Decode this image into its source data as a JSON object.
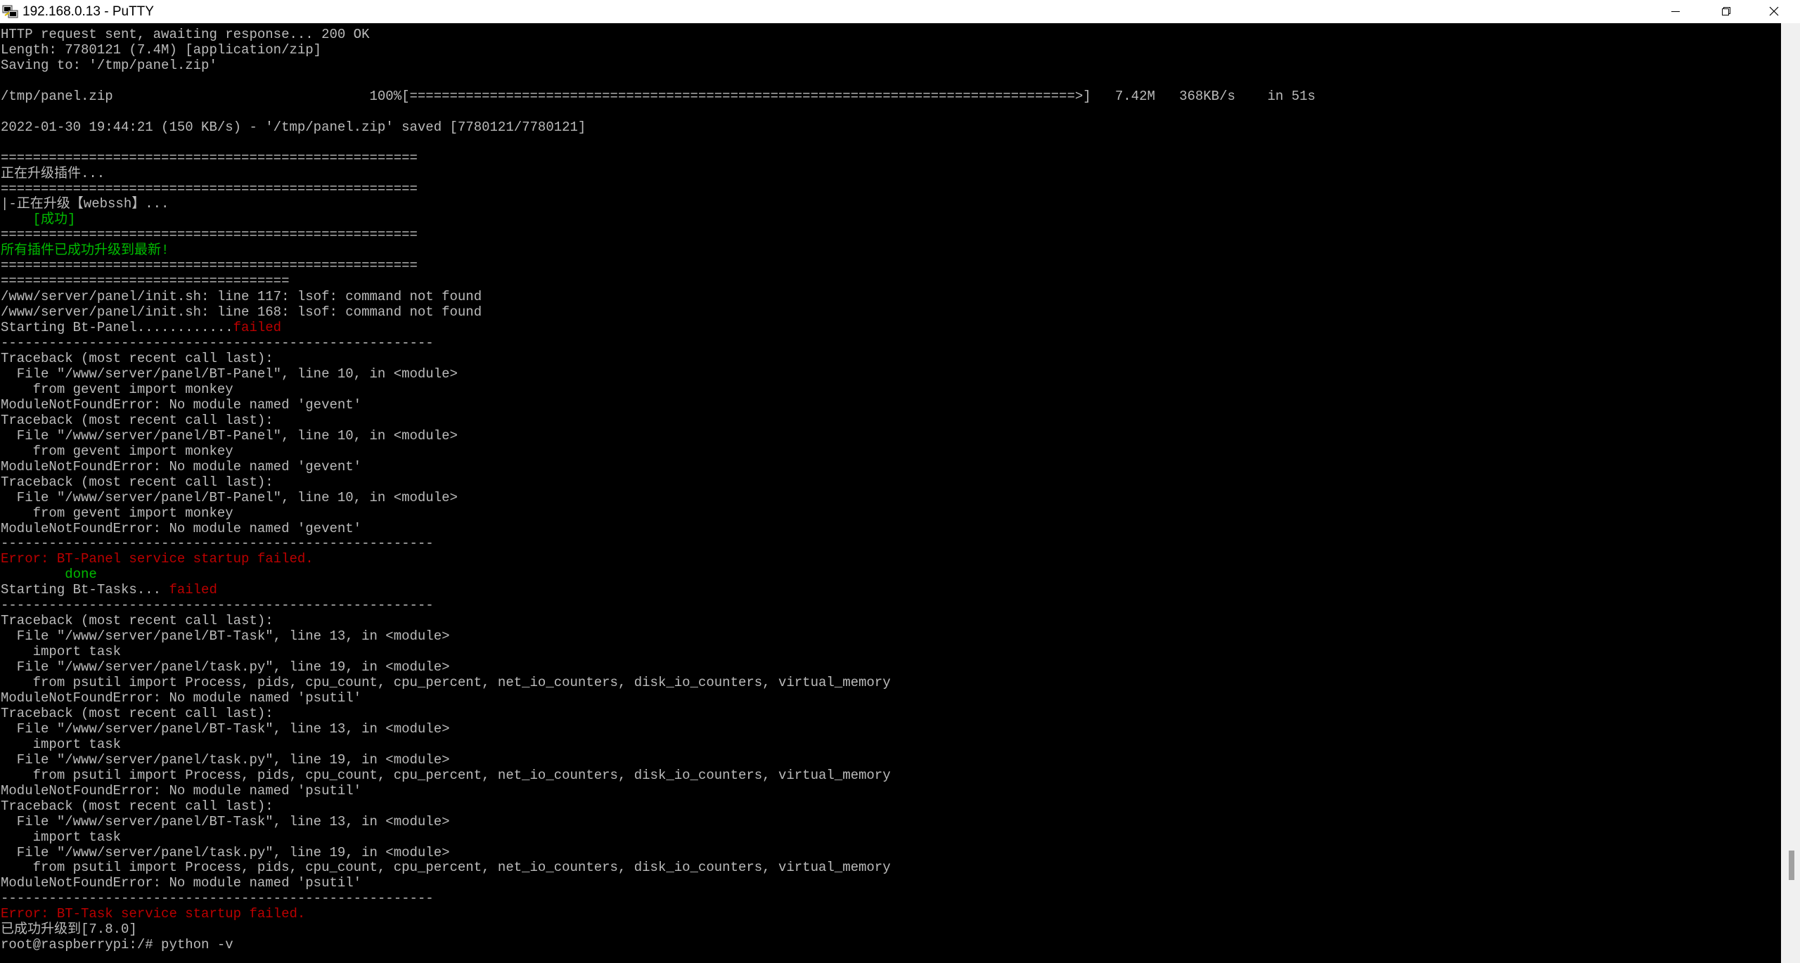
{
  "window": {
    "title": "192.168.0.13 - PuTTY",
    "controls": [
      "minimize",
      "restore",
      "close"
    ]
  },
  "colors": {
    "terminal_bg": "#000000",
    "text_default": "#bbbbbb",
    "text_green": "#00bb00",
    "text_red": "#bb0000"
  },
  "terminal": {
    "lines": [
      [
        {
          "t": "HTTP request sent, awaiting response... 200 OK"
        }
      ],
      [
        {
          "t": "Length: 7780121 (7.4M) [application/zip]"
        }
      ],
      [
        {
          "t": "Saving to: '/tmp/panel.zip'"
        }
      ],
      [
        {
          "t": ""
        }
      ],
      [
        {
          "t": "/tmp/panel.zip                                100%[===================================================================================>]   7.42M   368KB/s    in 51s"
        }
      ],
      [
        {
          "t": ""
        }
      ],
      [
        {
          "t": "2022-01-30 19:44:21 (150 KB/s) - '/tmp/panel.zip' saved [7780121/7780121]"
        }
      ],
      [
        {
          "t": ""
        }
      ],
      [
        {
          "t": "===================================================="
        }
      ],
      [
        {
          "t": "正在升级插件..."
        }
      ],
      [
        {
          "t": "===================================================="
        }
      ],
      [
        {
          "t": "|-正在升级【webssh】..."
        }
      ],
      [
        {
          "t": "    [成功]",
          "c": "green"
        }
      ],
      [
        {
          "t": "===================================================="
        }
      ],
      [
        {
          "t": "所有插件已成功升级到最新!",
          "c": "green"
        }
      ],
      [
        {
          "t": "===================================================="
        }
      ],
      [
        {
          "t": "===================================="
        }
      ],
      [
        {
          "t": "/www/server/panel/init.sh: line 117: lsof: command not found"
        }
      ],
      [
        {
          "t": "/www/server/panel/init.sh: line 168: lsof: command not found"
        }
      ],
      [
        {
          "t": "Starting Bt-Panel............"
        },
        {
          "t": "failed",
          "c": "red"
        }
      ],
      [
        {
          "t": "------------------------------------------------------"
        }
      ],
      [
        {
          "t": "Traceback (most recent call last):"
        }
      ],
      [
        {
          "t": "  File \"/www/server/panel/BT-Panel\", line 10, in <module>"
        }
      ],
      [
        {
          "t": "    from gevent import monkey"
        }
      ],
      [
        {
          "t": "ModuleNotFoundError: No module named 'gevent'"
        }
      ],
      [
        {
          "t": "Traceback (most recent call last):"
        }
      ],
      [
        {
          "t": "  File \"/www/server/panel/BT-Panel\", line 10, in <module>"
        }
      ],
      [
        {
          "t": "    from gevent import monkey"
        }
      ],
      [
        {
          "t": "ModuleNotFoundError: No module named 'gevent'"
        }
      ],
      [
        {
          "t": "Traceback (most recent call last):"
        }
      ],
      [
        {
          "t": "  File \"/www/server/panel/BT-Panel\", line 10, in <module>"
        }
      ],
      [
        {
          "t": "    from gevent import monkey"
        }
      ],
      [
        {
          "t": "ModuleNotFoundError: No module named 'gevent'"
        }
      ],
      [
        {
          "t": "------------------------------------------------------"
        }
      ],
      [
        {
          "t": "Error: BT-Panel service startup failed.",
          "c": "red"
        }
      ],
      [
        {
          "t": "        done",
          "c": "green"
        }
      ],
      [
        {
          "t": "Starting Bt-Tasks... "
        },
        {
          "t": "failed",
          "c": "red"
        }
      ],
      [
        {
          "t": "------------------------------------------------------"
        }
      ],
      [
        {
          "t": "Traceback (most recent call last):"
        }
      ],
      [
        {
          "t": "  File \"/www/server/panel/BT-Task\", line 13, in <module>"
        }
      ],
      [
        {
          "t": "    import task"
        }
      ],
      [
        {
          "t": "  File \"/www/server/panel/task.py\", line 19, in <module>"
        }
      ],
      [
        {
          "t": "    from psutil import Process, pids, cpu_count, cpu_percent, net_io_counters, disk_io_counters, virtual_memory"
        }
      ],
      [
        {
          "t": "ModuleNotFoundError: No module named 'psutil'"
        }
      ],
      [
        {
          "t": "Traceback (most recent call last):"
        }
      ],
      [
        {
          "t": "  File \"/www/server/panel/BT-Task\", line 13, in <module>"
        }
      ],
      [
        {
          "t": "    import task"
        }
      ],
      [
        {
          "t": "  File \"/www/server/panel/task.py\", line 19, in <module>"
        }
      ],
      [
        {
          "t": "    from psutil import Process, pids, cpu_count, cpu_percent, net_io_counters, disk_io_counters, virtual_memory"
        }
      ],
      [
        {
          "t": "ModuleNotFoundError: No module named 'psutil'"
        }
      ],
      [
        {
          "t": "Traceback (most recent call last):"
        }
      ],
      [
        {
          "t": "  File \"/www/server/panel/BT-Task\", line 13, in <module>"
        }
      ],
      [
        {
          "t": "    import task"
        }
      ],
      [
        {
          "t": "  File \"/www/server/panel/task.py\", line 19, in <module>"
        }
      ],
      [
        {
          "t": "    from psutil import Process, pids, cpu_count, cpu_percent, net_io_counters, disk_io_counters, virtual_memory"
        }
      ],
      [
        {
          "t": "ModuleNotFoundError: No module named 'psutil'"
        }
      ],
      [
        {
          "t": "------------------------------------------------------"
        }
      ],
      [
        {
          "t": "Error: BT-Task service startup failed.",
          "c": "red"
        }
      ],
      [
        {
          "t": "已成功升级到[7.8.0]"
        }
      ],
      [
        {
          "t": "root@raspberrypi:/# python -v"
        }
      ]
    ]
  }
}
